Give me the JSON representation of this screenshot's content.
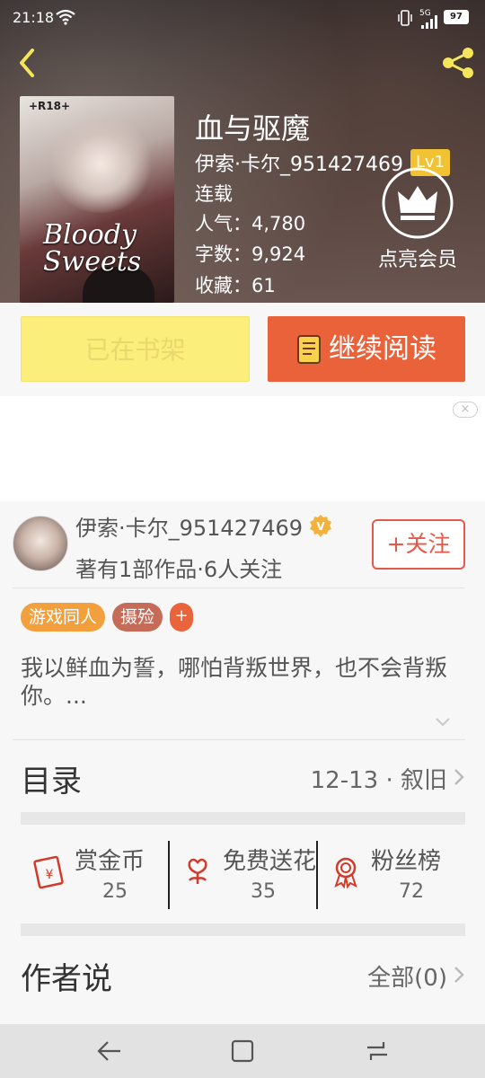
{
  "status_bar": {
    "time": "21:18",
    "network": "5G",
    "battery": "97"
  },
  "book": {
    "title": "血与驱魔",
    "author": "伊索·卡尔_951427469",
    "level": "Lv1",
    "status": "连载",
    "popularity": "人气：4,780",
    "words": "字数：9,924",
    "favorites": "收藏：61",
    "cover_tag": "+R18+",
    "cover_art_text": "Bloody Sweets"
  },
  "vip": {
    "label": "点亮会员"
  },
  "actions": {
    "shelf_label": "已在书架",
    "read_label": "继续阅读"
  },
  "ad": {
    "close_label": "×"
  },
  "author_card": {
    "name": "伊索·卡尔_951427469",
    "verified_badge": "V",
    "summary": "著有1部作品·6人关注",
    "follow_label": "+关注"
  },
  "tags": {
    "items": [
      "游戏同人",
      "摄殓"
    ],
    "add_label": "+"
  },
  "intro": "我以鲜血为誓，哪怕背叛世界，也不会背叛你。...",
  "toc": {
    "title": "目录",
    "latest": "12-13 · 叙旧"
  },
  "stats": {
    "reward": {
      "label": "赏金币",
      "value": "25"
    },
    "flowers": {
      "label": "免费送花",
      "value": "35"
    },
    "fans": {
      "label": "粉丝榜",
      "value": "72"
    }
  },
  "author_says": {
    "title": "作者说",
    "count": "全部(0)"
  },
  "colors": {
    "accent": "#e9623a",
    "shelf_bg": "#fbee7a",
    "follow": "#e45a4a",
    "tag_game": "#f2a03d",
    "tag_other": "#c56b58"
  }
}
